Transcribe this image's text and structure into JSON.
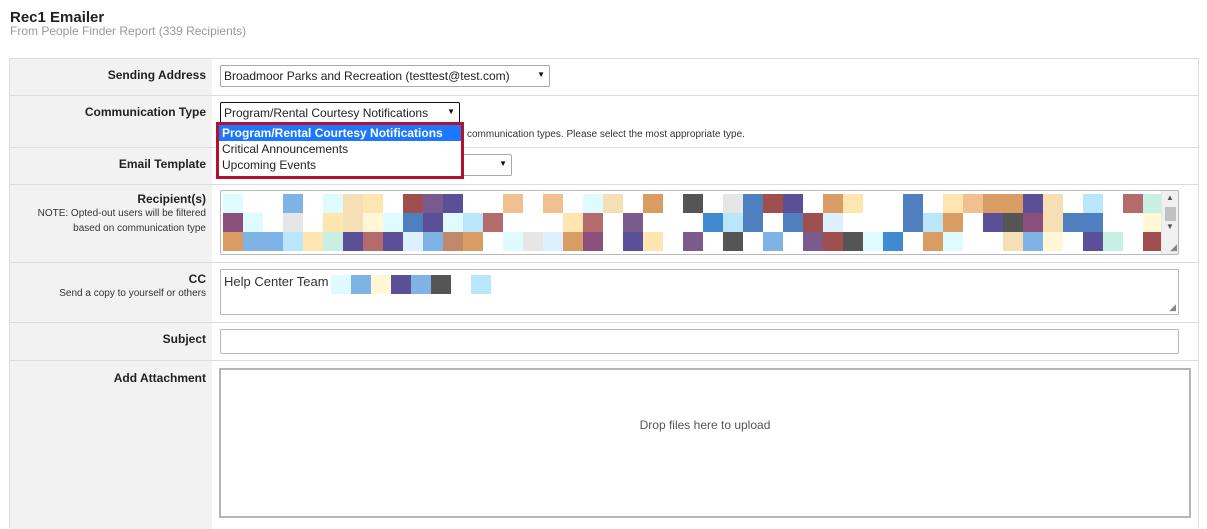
{
  "header": {
    "title": "Rec1 Emailer",
    "subtitle": "From People Finder Report (339 Recipients)"
  },
  "form": {
    "sending_address": {
      "label": "Sending Address",
      "value": "Broadmoor Parks and Recreation (testtest@test.com)"
    },
    "communication_type": {
      "label": "Communication Type",
      "value": "Program/Rental Courtesy Notifications",
      "hint": "communication types. Please select the most appropriate type.",
      "options": [
        "Program/Rental Courtesy Notifications",
        "Critical Announcements",
        "Upcoming Events"
      ],
      "selected_index": 0
    },
    "email_template": {
      "label": "Email Template",
      "value": ""
    },
    "recipients": {
      "label": "Recipient(s)",
      "note": "NOTE: Opted-out users will be filtered based on communication type"
    },
    "cc": {
      "label": "CC",
      "note": "Send a copy to yourself or others",
      "value": "Help Center Team"
    },
    "subject": {
      "label": "Subject",
      "value": ""
    },
    "attachment": {
      "label": "Add Attachment",
      "dropzone_text": "Drop files here to upload"
    }
  },
  "icons": {
    "select_arrow": "chevron-down-icon",
    "scroll_up": "scroll-up-icon",
    "scroll_down": "scroll-down-icon",
    "resize": "resize-grip-icon"
  },
  "colors": {
    "dropdown_highlight": "#1e78ff",
    "dropdown_border": "#b3112e",
    "label_background": "#f2f2f2"
  }
}
